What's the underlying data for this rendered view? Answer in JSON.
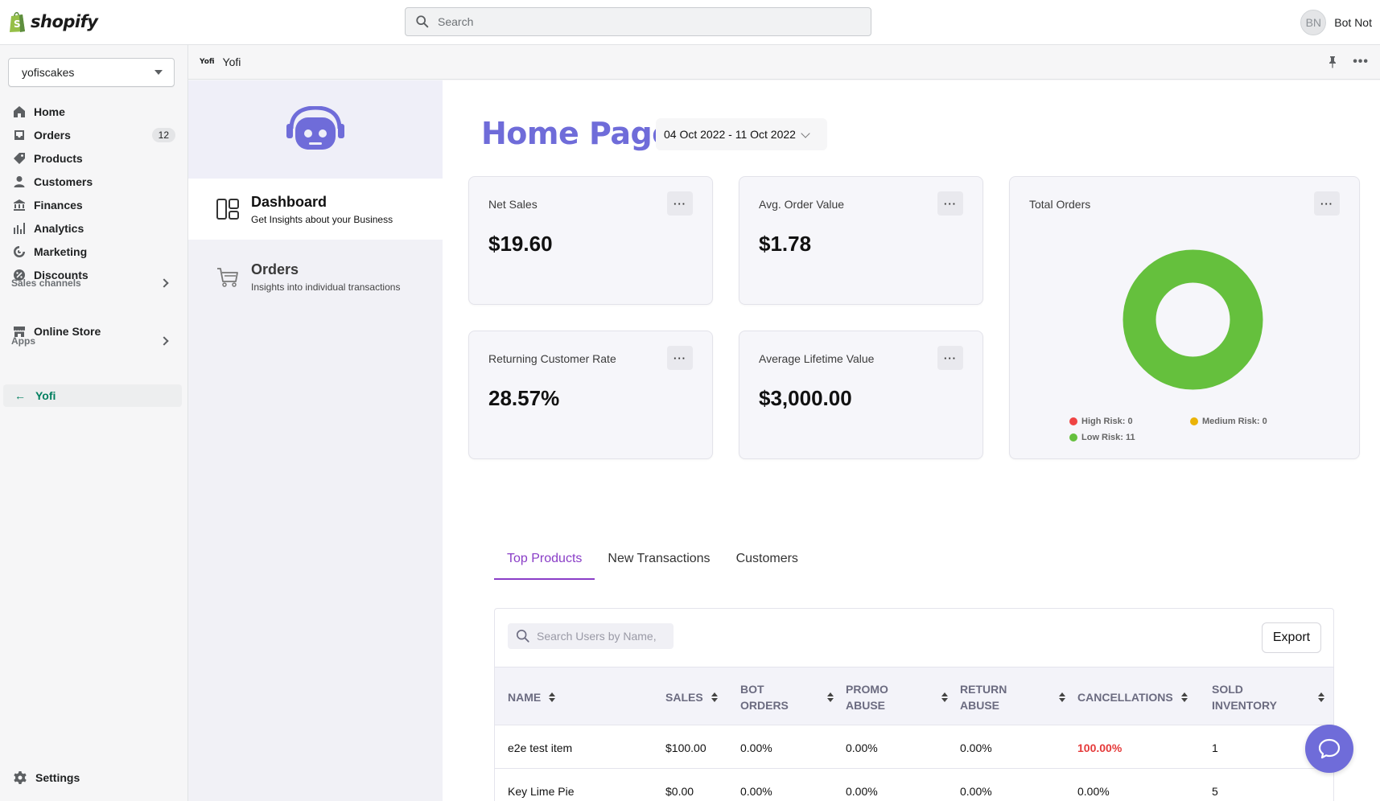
{
  "topbar": {
    "brand": "shopify",
    "search_placeholder": "Search",
    "user_initials": "BN",
    "user_name": "Bot Not"
  },
  "sidebar": {
    "store": "yofiscakes",
    "items": [
      {
        "label": "Home",
        "icon": "home-icon"
      },
      {
        "label": "Orders",
        "icon": "orders-icon",
        "badge": "12"
      },
      {
        "label": "Products",
        "icon": "tag-icon"
      },
      {
        "label": "Customers",
        "icon": "person-icon"
      },
      {
        "label": "Finances",
        "icon": "bank-icon"
      },
      {
        "label": "Analytics",
        "icon": "bar-chart-icon"
      },
      {
        "label": "Marketing",
        "icon": "target-icon"
      },
      {
        "label": "Discounts",
        "icon": "discount-icon"
      }
    ],
    "sales_channels_label": "Sales channels",
    "online_store": "Online Store",
    "apps_label": "Apps",
    "active_app": "Yofi",
    "settings": "Settings"
  },
  "app_header": {
    "logo_text": "Yofi",
    "title": "Yofi"
  },
  "app_nav": {
    "items": [
      {
        "title": "Dashboard",
        "subtitle": "Get Insights about your Business",
        "icon": "dashboard-icon"
      },
      {
        "title": "Orders",
        "subtitle": "Insights into individual transactions",
        "icon": "cart-icon"
      }
    ]
  },
  "main": {
    "title": "Home Page",
    "date_range": "04 Oct 2022 - 11 Oct 2022",
    "cards": [
      {
        "label": "Net Sales",
        "value": "$19.60"
      },
      {
        "label": "Avg. Order Value",
        "value": "$1.78"
      },
      {
        "label": "Returning Customer Rate",
        "value": "28.57%"
      },
      {
        "label": "Average Lifetime Value",
        "value": "$3,000.00"
      }
    ],
    "card_more": "···",
    "total_orders": {
      "label": "Total Orders",
      "legend": [
        {
          "label": "High Risk: 0",
          "color": "#ef4444",
          "value": 0
        },
        {
          "label": "Medium Risk: 0",
          "color": "#eab308",
          "value": 0
        },
        {
          "label": "Low Risk: 11",
          "color": "#65c03d",
          "value": 11
        }
      ]
    },
    "tabs": [
      "Top Products",
      "New Transactions",
      "Customers"
    ],
    "table": {
      "search_placeholder": "Search Users by Name,",
      "export_label": "Export",
      "columns": [
        [
          "NAME"
        ],
        [
          "SALES"
        ],
        [
          "BOT",
          "ORDERS"
        ],
        [
          "PROMO",
          "ABUSE"
        ],
        [
          "RETURN",
          "ABUSE"
        ],
        [
          "CANCELLATIONS"
        ],
        [
          "SOLD",
          "INVENTORY"
        ]
      ],
      "rows": [
        [
          "e2e test item",
          "$100.00",
          "0.00%",
          "0.00%",
          "0.00%",
          "100.00%",
          "1"
        ],
        [
          "Key Lime Pie",
          "$0.00",
          "0.00%",
          "0.00%",
          "0.00%",
          "0.00%",
          "5"
        ]
      ]
    }
  },
  "colors": {
    "accent": "#6f6cd9",
    "tab_active": "#8a3ec7",
    "danger": "#e53a3a",
    "success": "#65c03d"
  }
}
